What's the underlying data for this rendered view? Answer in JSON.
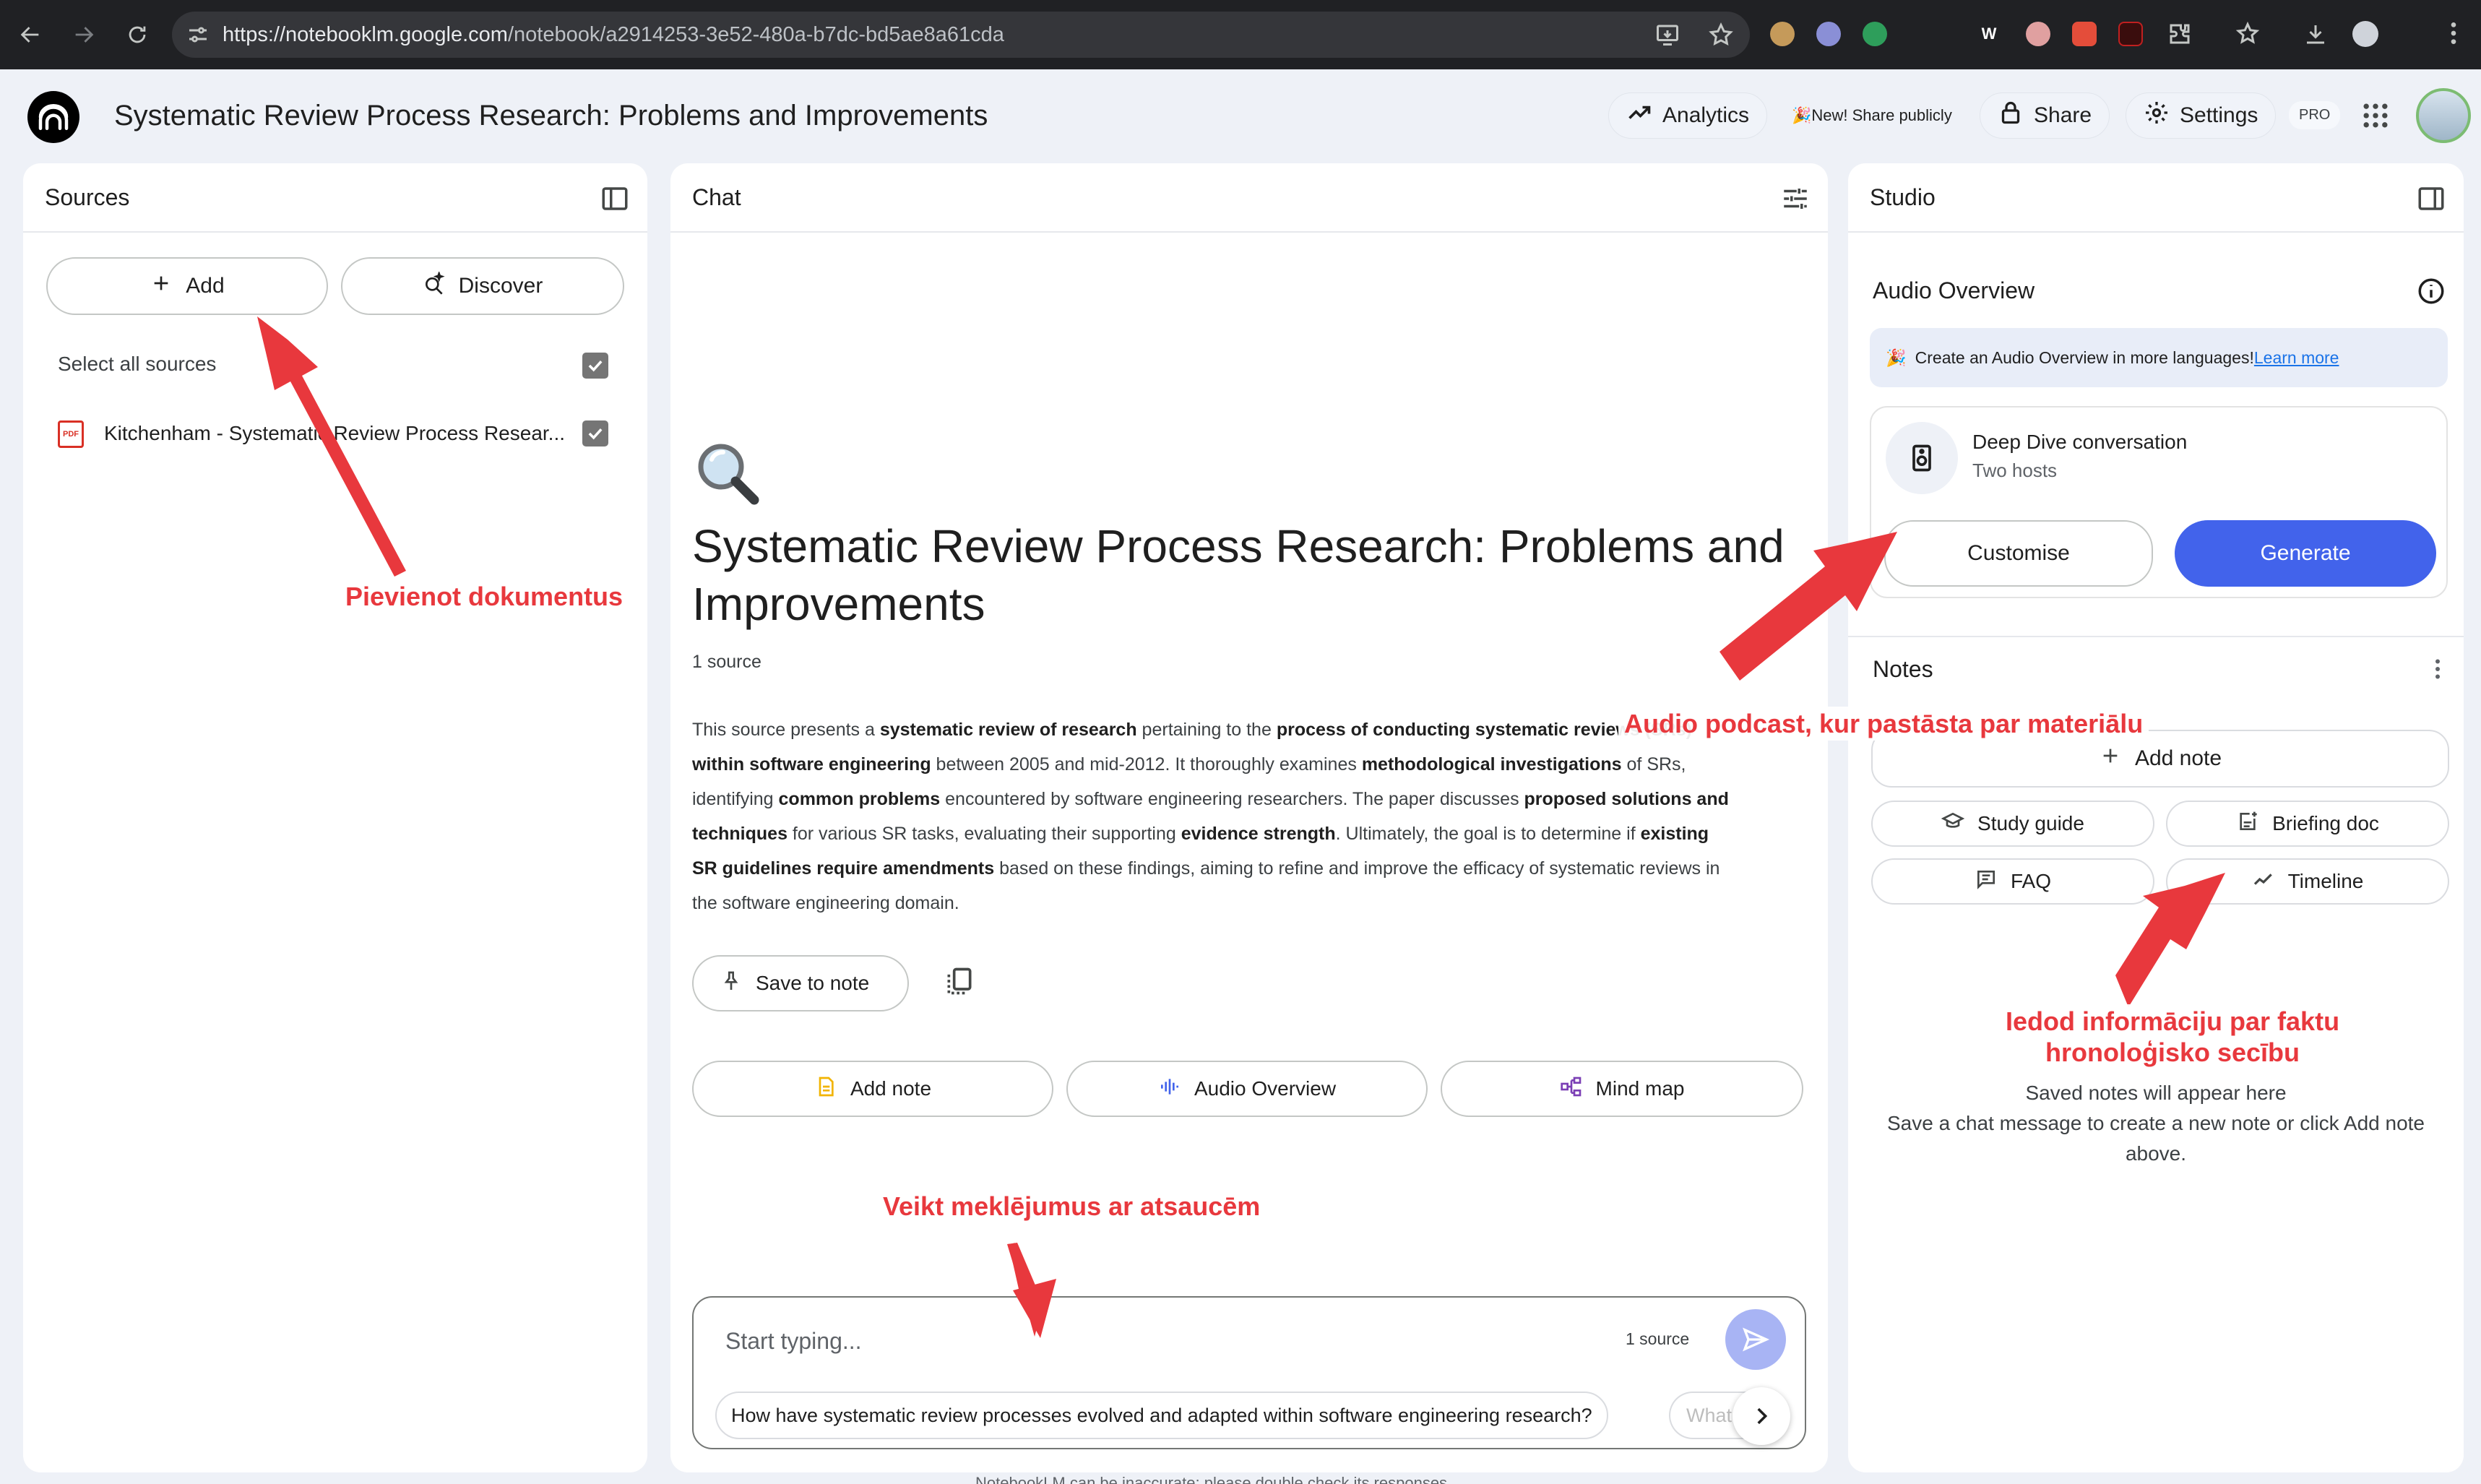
{
  "browser": {
    "url_host": "https://notebooklm.google.com",
    "url_path": "/notebook/a2914253-3e52-480a-b7dc-bd5ae8a61cda"
  },
  "header": {
    "title": "Systematic Review Process Research: Problems and Improvements",
    "analytics_label": "Analytics",
    "share_publicly_label": "🎉New! Share publicly",
    "share_label": "Share",
    "settings_label": "Settings",
    "pro_badge": "PRO"
  },
  "sources": {
    "title": "Sources",
    "add_label": "Add",
    "discover_label": "Discover",
    "select_all_label": "Select all sources",
    "items": [
      {
        "name": "Kitchenham - Systematic Review Process Resear...",
        "type_badge": "PDF",
        "checked": true
      }
    ]
  },
  "chat": {
    "title": "Chat",
    "emoji": "🔍",
    "notebook_title": "Systematic Review Process Research: Problems and Improvements",
    "source_count": "1 source",
    "summary": [
      {
        "t": "This source presents a ",
        "b": false
      },
      {
        "t": "systematic review of research",
        "b": true
      },
      {
        "t": " pertaining to the ",
        "b": false
      },
      {
        "t": "process of conducting systematic reviews (SRs)",
        "b": true
      },
      {
        "t": " ",
        "b": false
      },
      {
        "t": "within software engineering",
        "b": true
      },
      {
        "t": " between 2005 and mid-2012. It thoroughly examines ",
        "b": false
      },
      {
        "t": "methodological investigations",
        "b": true
      },
      {
        "t": " of SRs, identifying ",
        "b": false
      },
      {
        "t": "common problems",
        "b": true
      },
      {
        "t": " encountered by software engineering researchers. The paper discusses ",
        "b": false
      },
      {
        "t": "proposed solutions and techniques",
        "b": true
      },
      {
        "t": " for various SR tasks, evaluating their supporting ",
        "b": false
      },
      {
        "t": "evidence strength",
        "b": true
      },
      {
        "t": ". Ultimately, the goal is to determine if ",
        "b": false
      },
      {
        "t": "existing SR guidelines require amendments",
        "b": true
      },
      {
        "t": " based on these findings, aiming to refine and improve the efficacy of systematic reviews in the software engineering domain.",
        "b": false
      }
    ],
    "save_to_note_label": "Save to note",
    "actions": {
      "add_note": "Add note",
      "audio_overview": "Audio Overview",
      "mind_map": "Mind map"
    },
    "input_placeholder": "Start typing...",
    "input_source_count": "1 source",
    "suggestion": "How have systematic review processes evolved and adapted within software engineering research?",
    "suggestion_next_cut": "What",
    "footer": "NotebookLM can be inaccurate; please double check its responses."
  },
  "studio": {
    "title": "Studio",
    "audio_overview_title": "Audio Overview",
    "banner_text": "Create an Audio Overview in more languages!",
    "banner_link": "Learn more",
    "banner_emoji": "🎉",
    "deep_dive_title": "Deep Dive conversation",
    "deep_dive_sub": "Two hosts",
    "customise_label": "Customise",
    "generate_label": "Generate",
    "notes_title": "Notes",
    "add_note_label": "Add note",
    "study_guide_label": "Study guide",
    "briefing_doc_label": "Briefing doc",
    "faq_label": "FAQ",
    "timeline_label": "Timeline",
    "empty_title": "Saved notes will appear here",
    "empty_sub": "Save a chat message to create a new note or click Add note above."
  },
  "annotations": {
    "add_docs": "Pievienot dokumentus",
    "audio_podcast": "Audio podcast, kur  pastāsta par materiālu",
    "timeline_line1": "Iedod informāciju par faktu",
    "timeline_line2": "hronoloģisko secību",
    "search_refs": "Veikt meklējumus ar atsaucēm"
  },
  "colors": {
    "annotation_red": "#e8383d",
    "generate_blue": "#4263eb",
    "page_bg": "#eef1f7"
  }
}
